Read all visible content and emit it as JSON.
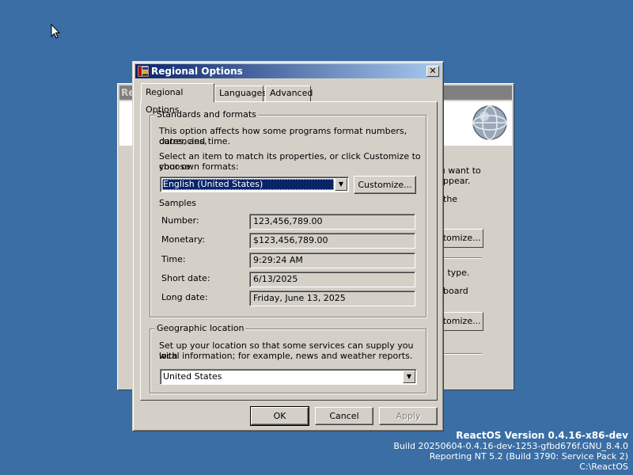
{
  "background_window": {
    "title": "Re",
    "texts": [
      "ou want to",
      "ppear.",
      "the",
      "u type.",
      "board"
    ],
    "buttons": [
      "stomize...",
      "stomize..."
    ]
  },
  "dialog": {
    "title": "Regional Options",
    "close_label": "✕",
    "tabs": [
      "Regional Options",
      "Languages",
      "Advanced"
    ],
    "standards": {
      "label": "Standards and formats",
      "desc1": "This option affects how some programs format numbers, currencies,",
      "desc2": "dates, and time.",
      "desc3": "Select an item to match its properties, or click Customize to choose",
      "desc4": "your own formats:",
      "locale": "English (United States)",
      "customize": "Customize...",
      "samples_label": "Samples",
      "samples": [
        {
          "label": "Number:",
          "value": "123,456,789.00"
        },
        {
          "label": "Monetary:",
          "value": "$123,456,789.00"
        },
        {
          "label": "Time:",
          "value": "9:29:24 AM"
        },
        {
          "label": "Short date:",
          "value": "6/13/2025"
        },
        {
          "label": "Long date:",
          "value": "Friday, June 13, 2025"
        }
      ]
    },
    "geo": {
      "label": "Geographic location",
      "desc1": "Set up your location so that some services can supply you with",
      "desc2": "local information; for example, news and weather reports.",
      "location": "United States"
    },
    "buttons": {
      "ok": "OK",
      "cancel": "Cancel",
      "apply": "Apply"
    }
  },
  "version": {
    "line1": "ReactOS Version 0.4.16-x86-dev",
    "line2": "Build 20250604-0.4.16-dev-1253-gfbd676f.GNU_8.4.0",
    "line3": "Reporting NT 5.2 (Build 3790: Service Pack 2)",
    "line4": "C:\\ReactOS"
  }
}
